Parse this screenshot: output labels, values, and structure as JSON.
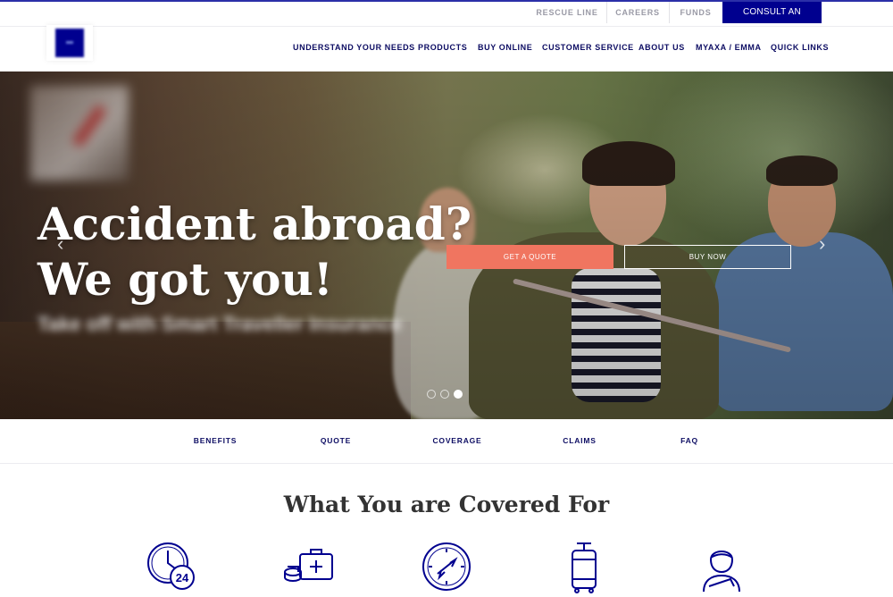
{
  "utility": {
    "rescue_line": "RESCUE LINE",
    "careers": "CAREERS",
    "funds": "FUNDS",
    "consult": "CONSULT AN ADVISOR"
  },
  "nav": {
    "items": [
      "UNDERSTAND YOUR NEEDS",
      "PRODUCTS",
      "BUY ONLINE",
      "CUSTOMER SERVICE",
      "ABOUT US",
      "MYAXA / EMMA",
      "QUICK LINKS"
    ]
  },
  "hero": {
    "title_line1": "Accident abroad?",
    "title_line2": "We got you!",
    "subtitle": "Take off with Smart Traveller Insurance",
    "quote_button": "GET A QUOTE",
    "buy_button": "BUY NOW",
    "prev_arrow": "‹",
    "next_arrow": "›",
    "slides": 3,
    "active_slide": 3
  },
  "section_nav": [
    "BENEFITS",
    "QUOTE",
    "COVERAGE",
    "CLAIMS",
    "FAQ"
  ],
  "covered": {
    "title": "What You are Covered For",
    "icons": [
      "clock-24-icon",
      "medical-kit-icon",
      "compass-plane-icon",
      "luggage-icon",
      "injured-person-icon"
    ],
    "clock_badge": "24"
  },
  "colors": {
    "brand": "#00008f",
    "nav_text": "#0d0d63",
    "quote_button": "#f07560"
  }
}
